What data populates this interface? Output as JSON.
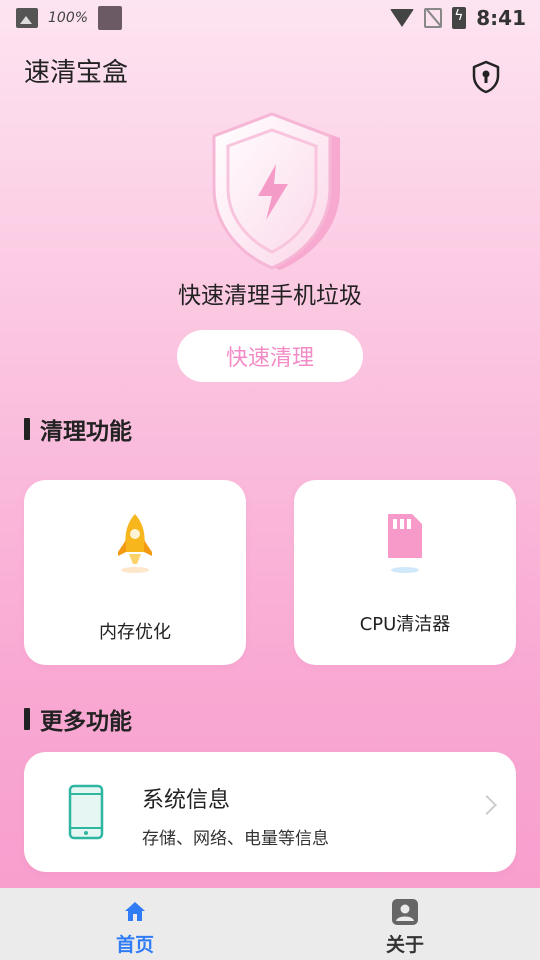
{
  "status_bar": {
    "battery_percent": "100%",
    "time": "8:41",
    "icons": [
      "image-icon",
      "app-square-icon",
      "wifi-icon",
      "no-sim-icon",
      "battery-charging-icon"
    ]
  },
  "header": {
    "title": "速清宝盒",
    "privacy_icon": "shield-lock-icon"
  },
  "hero": {
    "icon": "lightning-shield-icon",
    "text": "快速清理手机垃圾",
    "button_label": "快速清理"
  },
  "sections": {
    "clean": {
      "title": "清理功能"
    },
    "more": {
      "title": "更多功能"
    }
  },
  "cards": {
    "memory": {
      "label": "内存优化",
      "icon": "rocket-icon"
    },
    "cpu": {
      "label": "CPU清洁器",
      "icon": "sd-card-icon"
    }
  },
  "list": {
    "system_info": {
      "title": "系统信息",
      "subtitle": "存储、网络、电量等信息",
      "icon": "phone-icon"
    }
  },
  "bottom_nav": {
    "items": [
      {
        "label": "首页",
        "icon": "home-icon",
        "active": true
      },
      {
        "label": "关于",
        "icon": "person-card-icon",
        "active": false
      }
    ]
  },
  "colors": {
    "accent_pink": "#f38bc6",
    "active_nav": "#2f7cf6",
    "inactive_nav": "#333333",
    "phone_icon": "#2fb6a0",
    "rocket": "#f7b61c"
  }
}
